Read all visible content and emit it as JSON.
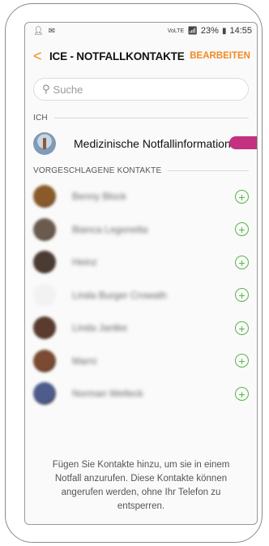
{
  "status": {
    "left_icons": [
      "person-icon",
      "notification-icon"
    ],
    "network": "VoLTE",
    "battery": "23%",
    "time": "14:55"
  },
  "header": {
    "back_glyph": "<",
    "title": "ICE - NOTFALLKONTAKTE",
    "edit_label": "BEARBEITEN"
  },
  "search": {
    "placeholder": "Suche"
  },
  "me_section": {
    "label": "ICH",
    "item_label": "Medizinische Notfallinformation"
  },
  "suggested_section": {
    "label": "VORGESCHLAGENE KONTAKTE",
    "contacts": [
      {
        "name": "Benny Block",
        "avatar_color": "#8a5a2a"
      },
      {
        "name": "Bianca Legonetta",
        "avatar_color": "#6b5b4e"
      },
      {
        "name": "Heinz",
        "avatar_color": "#4a3b33"
      },
      {
        "name": "Linda Burger Crowath",
        "avatar_color": "#f2f2f2"
      },
      {
        "name": "Linda Jantke",
        "avatar_color": "#5a3b2e"
      },
      {
        "name": "Marni",
        "avatar_color": "#7a4a32"
      },
      {
        "name": "Norman Welleck",
        "avatar_color": "#4d5c8a"
      }
    ]
  },
  "footer": {
    "text": "Fügen Sie Kontakte hinzu, um sie in einem Notfall anzurufen. Diese Kontakte können angerufen werden, ohne Ihr Telefon zu entsperren."
  },
  "colors": {
    "accent": "#f08a21",
    "add": "#54b646",
    "pointer": "#c3317f"
  }
}
